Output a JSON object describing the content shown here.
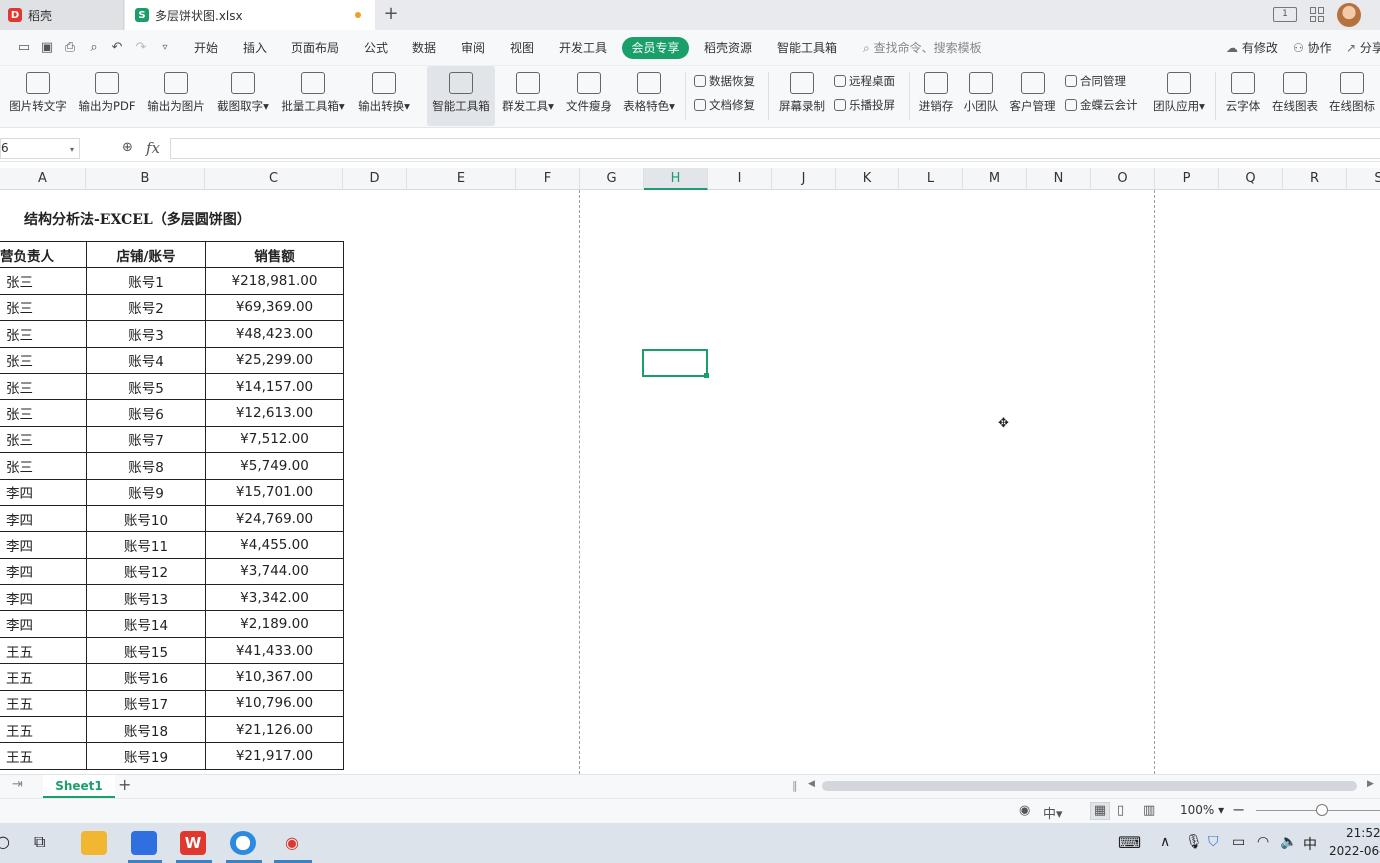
{
  "tabs": [
    {
      "label": "稻壳",
      "icon": "daoke-icon"
    },
    {
      "label": "多层饼状图.xlsx",
      "icon": "spreadsheet-icon"
    }
  ],
  "menu": {
    "items": [
      "开始",
      "插入",
      "页面布局",
      "公式",
      "数据",
      "审阅",
      "视图",
      "开发工具"
    ],
    "vip": "会员专享",
    "items_after": [
      "稻壳资源",
      "智能工具箱"
    ],
    "search_placeholder": "查找命令、搜索模板",
    "modified": "有修改",
    "collab": "协作",
    "share": "分享"
  },
  "ribbon": {
    "big": [
      "图片转文字",
      "输出为PDF",
      "输出为图片",
      "截图取字",
      "批量工具箱",
      "输出转换",
      "智能工具箱",
      "群发工具",
      "文件瘦身",
      "表格特色"
    ],
    "small_group1": [
      "数据恢复",
      "文档修复"
    ],
    "screen_record": "屏幕录制",
    "small_group2": [
      "远程桌面",
      "乐播投屏"
    ],
    "big2": [
      "进销存",
      "小团队",
      "客户管理"
    ],
    "small_group3": [
      "合同管理",
      "金蝶云会计"
    ],
    "team_app": "团队应用",
    "big3": [
      "云字体",
      "在线图表",
      "在线图标"
    ]
  },
  "formula_bar": {
    "name_box": "6",
    "fx": "fx",
    "value": ""
  },
  "columns": [
    "A",
    "B",
    "C",
    "D",
    "E",
    "F",
    "G",
    "H",
    "I",
    "J",
    "K",
    "L",
    "M",
    "N",
    "O",
    "P",
    "Q",
    "R",
    "S"
  ],
  "selected_column": "H",
  "sheet": {
    "title": "结构分析法-EXCEL（多层圆饼图）",
    "headers": [
      "营负责人",
      "店铺/账号",
      "销售额"
    ],
    "rows": [
      [
        "张三",
        "账号1",
        "¥218,981.00"
      ],
      [
        "张三",
        "账号2",
        "¥69,369.00"
      ],
      [
        "张三",
        "账号3",
        "¥48,423.00"
      ],
      [
        "张三",
        "账号4",
        "¥25,299.00"
      ],
      [
        "张三",
        "账号5",
        "¥14,157.00"
      ],
      [
        "张三",
        "账号6",
        "¥12,613.00"
      ],
      [
        "张三",
        "账号7",
        "¥7,512.00"
      ],
      [
        "张三",
        "账号8",
        "¥5,749.00"
      ],
      [
        "李四",
        "账号9",
        "¥15,701.00"
      ],
      [
        "李四",
        "账号10",
        "¥24,769.00"
      ],
      [
        "李四",
        "账号11",
        "¥4,455.00"
      ],
      [
        "李四",
        "账号12",
        "¥3,744.00"
      ],
      [
        "李四",
        "账号13",
        "¥3,342.00"
      ],
      [
        "李四",
        "账号14",
        "¥2,189.00"
      ],
      [
        "王五",
        "账号15",
        "¥41,433.00"
      ],
      [
        "王五",
        "账号16",
        "¥10,367.00"
      ],
      [
        "王五",
        "账号17",
        "¥10,796.00"
      ],
      [
        "王五",
        "账号18",
        "¥21,126.00"
      ],
      [
        "王五",
        "账号19",
        "¥21,917.00"
      ]
    ]
  },
  "sheet_tabs": [
    "Sheet1"
  ],
  "status": {
    "zoom": "100%"
  },
  "taskbar": {
    "time": "21:52",
    "date": "2022-06-",
    "ime": "中"
  },
  "colors": {
    "accent": "#1a9f6b",
    "wps_red": "#e0382f"
  }
}
